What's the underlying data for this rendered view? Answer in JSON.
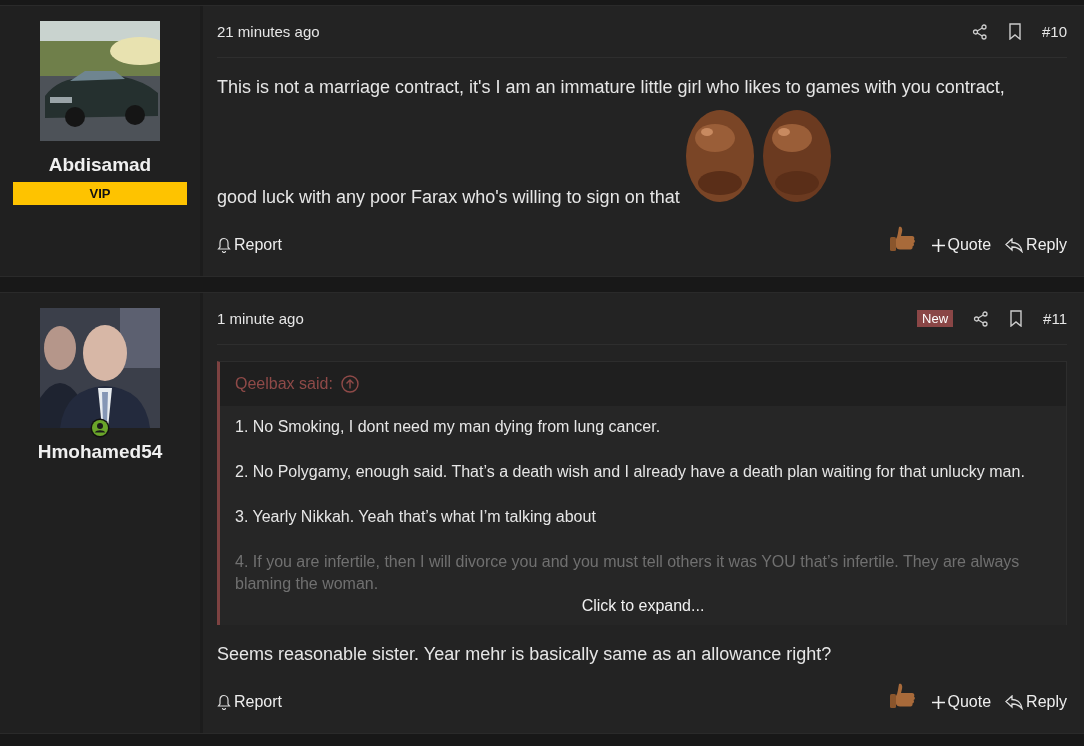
{
  "posts": [
    {
      "user": {
        "name": "Abdisamad",
        "banner": "VIP"
      },
      "time": "21 minutes ago",
      "number": "#10",
      "body": [
        [
          {
            "kind": "text",
            "text": "This is not a marriage contract, it's I am an immature little girl who likes to games with you contract,"
          }
        ],
        [
          {
            "kind": "text",
            "text": "good luck with any poor Farax who's willing to sign on that "
          },
          {
            "kind": "picture"
          },
          {
            "kind": "picture"
          }
        ]
      ],
      "actions": {
        "report": "Report",
        "quote": "Quote",
        "reply": "Reply"
      }
    },
    {
      "user": {
        "name": "Hmohamed54",
        "online": true
      },
      "time": "1 minute ago",
      "new_badge": "New",
      "number": "#11",
      "quote": {
        "author": "Qeelbax said:",
        "lines": [
          "1. No Smoking, I dont need my man dying from lung cancer.",
          "2. No Polygamy, enough said. That’s a death wish and I already have a death plan waiting for that unlucky man.",
          "3. Yearly Nikkah. Yeah that’s what I’m talking about"
        ],
        "faded": "4. If you are infertile, then I will divorce you and you must tell others it was YOU that’s infertile. They are always blaming the woman.",
        "expand": "Click to expand..."
      },
      "body": [
        [
          {
            "kind": "text",
            "text": "Seems reasonable sister. Year mehr is basically same as an allowance right?"
          }
        ]
      ],
      "actions": {
        "report": "Report",
        "quote": "Quote",
        "reply": "Reply"
      }
    }
  ]
}
